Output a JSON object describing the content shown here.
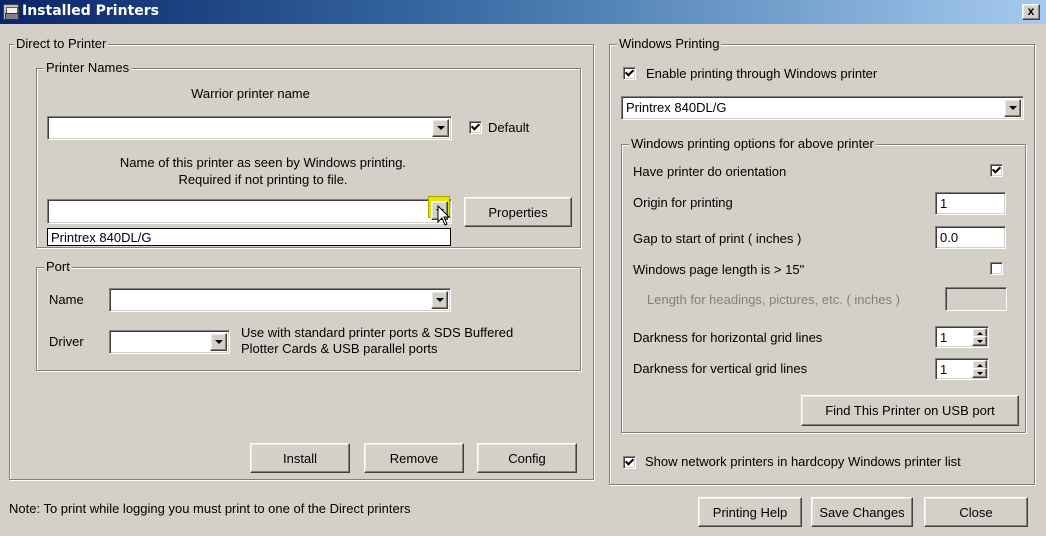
{
  "window": {
    "title": "Installed Printers",
    "close_glyph": "x"
  },
  "direct": {
    "legend": "Direct to Printer",
    "printer_names": {
      "legend": "Printer Names",
      "warrior_label": "Warrior printer name",
      "warrior_value": "",
      "default_label": "Default",
      "default_checked": true,
      "windows_name_label_line1": "Name of this printer as seen by Windows printing.",
      "windows_name_label_line2": "Required if not printing to file.",
      "windows_name_value": "",
      "dropdown_option": "Printrex 840DL/G",
      "properties_button": "Properties"
    },
    "port": {
      "legend": "Port",
      "name_label": "Name",
      "name_value": "",
      "driver_label": "Driver",
      "driver_value": "",
      "driver_note_line1": "Use with standard printer ports & SDS Buffered",
      "driver_note_line2": "Plotter Cards & USB parallel ports"
    },
    "install_button": "Install",
    "remove_button": "Remove",
    "config_button": "Config"
  },
  "windows_printing": {
    "legend": "Windows Printing",
    "enable_label": "Enable printing through Windows printer",
    "enable_checked": true,
    "printer_select": "Printrex 840DL/G",
    "options": {
      "legend": "Windows printing options for above printer",
      "orientation_label": "Have printer do orientation",
      "orientation_checked": true,
      "origin_label": "Origin for printing",
      "origin_value": "1",
      "gap_label": "Gap to start of print ( inches )",
      "gap_value": "0.0",
      "page_length_label": "Windows page length is > 15\"",
      "page_length_checked": false,
      "heading_length_label": "Length for headings, pictures, etc. ( inches )",
      "heading_length_value": "",
      "horiz_darkness_label": "Darkness for horizontal grid lines",
      "horiz_darkness_value": "1",
      "vert_darkness_label": "Darkness for vertical grid lines",
      "vert_darkness_value": "1",
      "find_usb_button": "Find This Printer on USB port"
    },
    "network_label": "Show network printers in hardcopy Windows printer list",
    "network_checked": true
  },
  "footer": {
    "note": "Note:  To print while logging you must print to one of the Direct printers",
    "help_button": "Printing Help",
    "save_button": "Save Changes",
    "close_button": "Close"
  },
  "icons": {
    "app": "printer-icon",
    "dropdown": "chevron-down-icon",
    "check": "checkmark-icon",
    "cursor": "mouse-pointer-icon"
  },
  "colors": {
    "face": "#d4d0c8",
    "title_start": "#0a246a",
    "title_end": "#a6caf0",
    "highlight": "#e5e500"
  }
}
